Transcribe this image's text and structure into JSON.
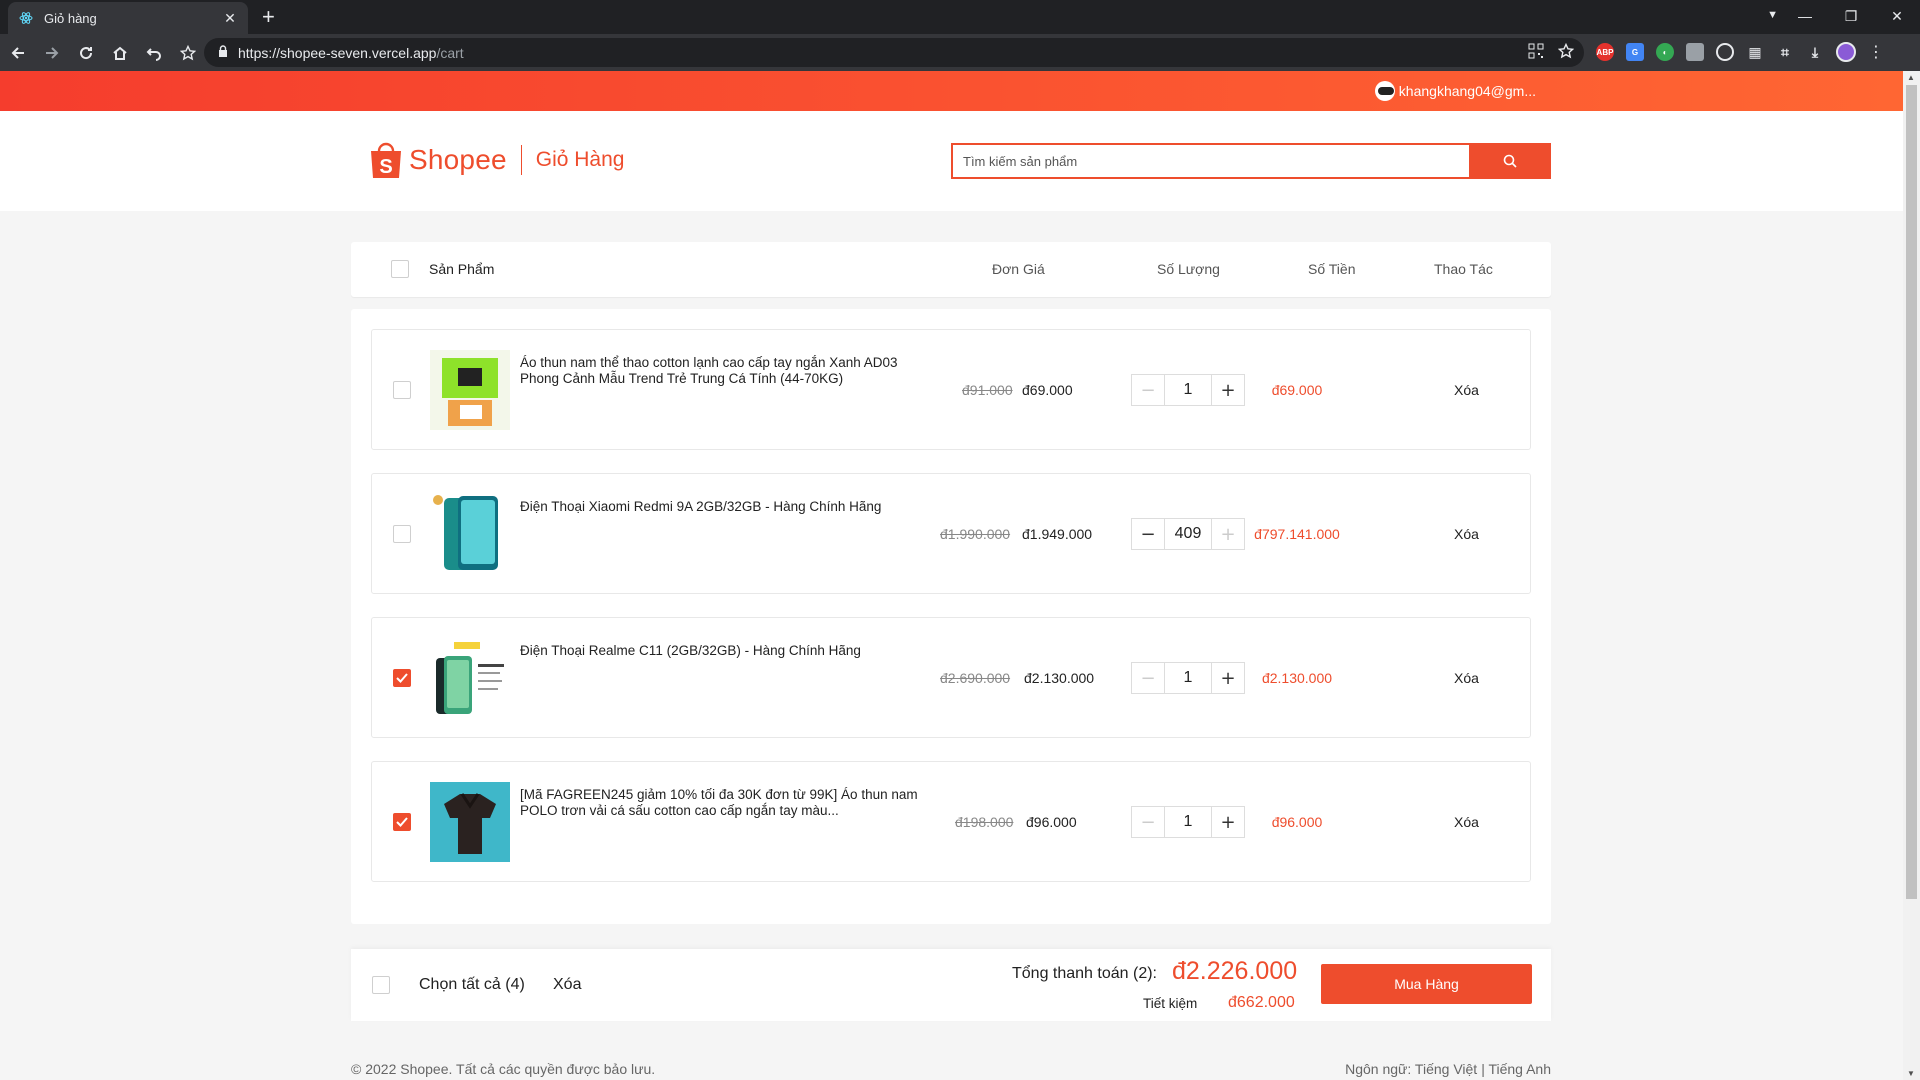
{
  "browser": {
    "tab_title": "Giỏ hàng",
    "tab_close": "✕",
    "new_tab": "+",
    "url_host": "https://shopee-seven.vercel.app",
    "url_path": "/cart",
    "extensions": [
      "qr-icon",
      "star-icon",
      "adblock-icon",
      "translate-icon",
      "extension-icon",
      "extension-icon",
      "target-icon",
      "grid-icon",
      "crop-icon",
      "download-icon"
    ],
    "download_badge": "1"
  },
  "topbar": {
    "user_email": "khangkhang04@gm..."
  },
  "header": {
    "brand": "Shopee",
    "page_title": "Giỏ Hàng",
    "search_placeholder": "Tìm kiếm sản phẩm"
  },
  "columns": {
    "product": "Sản Phẩm",
    "unit_price": "Đơn Giá",
    "quantity": "Số Lượng",
    "amount": "Số Tiền",
    "action": "Thao Tác"
  },
  "items": [
    {
      "name": "Áo thun nam thể thao cotton lạnh cao cấp tay ngắn Xanh AD03 Phong Cảnh Mẫu Trend Trẻ Trung Cá Tính (44-70KG)",
      "price_old": "đ91.000",
      "price_new": "đ69.000",
      "qty": "1",
      "total": "đ69.000",
      "delete": "Xóa",
      "checked": false
    },
    {
      "name": "Điện Thoại Xiaomi Redmi 9A 2GB/32GB - Hàng Chính Hãng",
      "price_old": "đ1.990.000",
      "price_new": "đ1.949.000",
      "qty": "409",
      "total": "đ797.141.000",
      "delete": "Xóa",
      "checked": false
    },
    {
      "name": "Điện Thoại Realme C11 (2GB/32GB) - Hàng Chính Hãng",
      "price_old": "đ2.690.000",
      "price_new": "đ2.130.000",
      "qty": "1",
      "total": "đ2.130.000",
      "delete": "Xóa",
      "checked": true
    },
    {
      "name": "[Mã FAGREEN245 giảm 10% tối đa 30K đơn từ 99K] Áo thun nam POLO trơn vải cá sấu cotton cao cấp ngắn tay màu...",
      "price_old": "đ198.000",
      "price_new": "đ96.000",
      "qty": "1",
      "total": "đ96.000",
      "delete": "Xóa",
      "checked": true
    }
  ],
  "footer": {
    "select_all": "Chọn tất cả (4)",
    "delete": "Xóa",
    "total_label": "Tổng thanh toán (2):",
    "total_value": "đ2.226.000",
    "save_label": "Tiết kiệm",
    "save_value": "đ662.000",
    "buy_button": "Mua Hàng"
  },
  "page_footer": {
    "copyright": "© 2022 Shopee. Tất cả các quyền được bảo lưu.",
    "language_label": "Ngôn ngữ: Tiếng Việt",
    "language_alt": "| Tiếng Anh"
  },
  "colors": {
    "brand": "#ee4d2d",
    "topbar_gradient_start": "#f53d2d",
    "topbar_gradient_end": "#ff6633"
  }
}
